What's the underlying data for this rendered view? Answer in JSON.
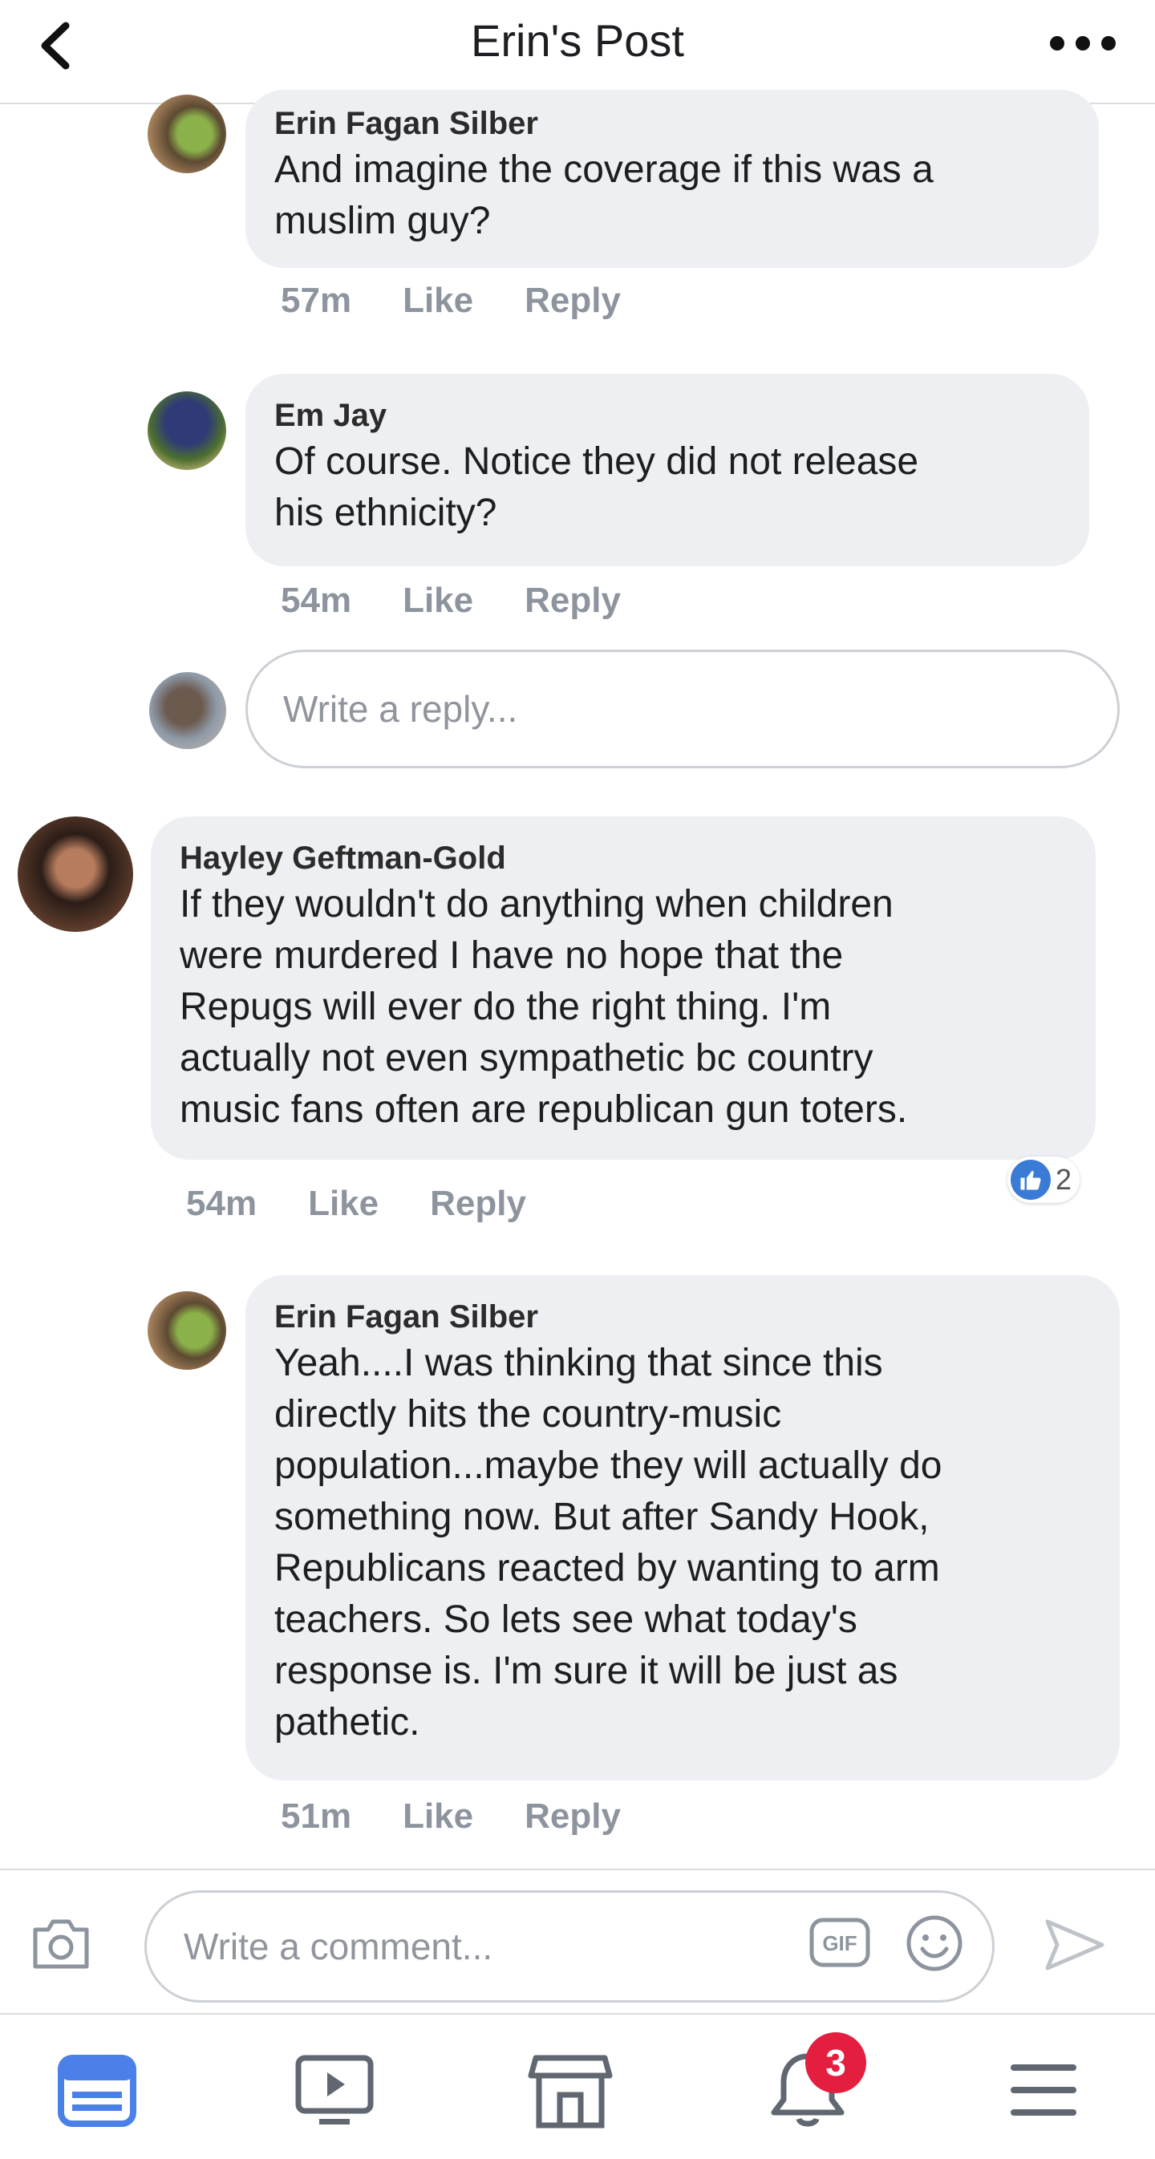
{
  "header": {
    "title": "Erin's Post"
  },
  "comments": [
    {
      "author": "Erin Fagan Silber",
      "lines": [
        "And imagine the coverage if this was a",
        "muslim guy?"
      ],
      "time": "57m",
      "like": "Like",
      "reply": "Reply"
    },
    {
      "author": "Em Jay",
      "lines": [
        "Of course. Notice they did not release",
        "his ethnicity?"
      ],
      "time": "54m",
      "like": "Like",
      "reply": "Reply"
    },
    {
      "author": "Hayley Geftman-Gold",
      "lines": [
        "If they wouldn't do anything when children",
        "were murdered I have no hope that the",
        "Repugs will ever do the right thing.  I'm",
        "actually not even sympathetic bc country",
        "music fans often are republican gun toters."
      ],
      "time": "54m",
      "like": "Like",
      "reply": "Reply",
      "reaction_count": "2"
    },
    {
      "author": "Erin Fagan Silber",
      "lines": [
        "Yeah....I was thinking that since this",
        "directly hits the country-music",
        "population...maybe they will actually do",
        "something now.  But after Sandy Hook,",
        "Republicans reacted by wanting to arm",
        "teachers.  So lets see what today's",
        "response is.  I'm sure it will be just as",
        "pathetic."
      ],
      "time": "51m",
      "like": "Like",
      "reply": "Reply"
    }
  ],
  "reply_box": {
    "placeholder": "Write a reply..."
  },
  "composer": {
    "placeholder": "Write a comment...",
    "gif_label": "GIF"
  },
  "tabbar": {
    "notification_badge": "3"
  },
  "colors": {
    "accent": "#4a80e8",
    "bubble": "#edeff2",
    "badge": "#e41e3f"
  }
}
